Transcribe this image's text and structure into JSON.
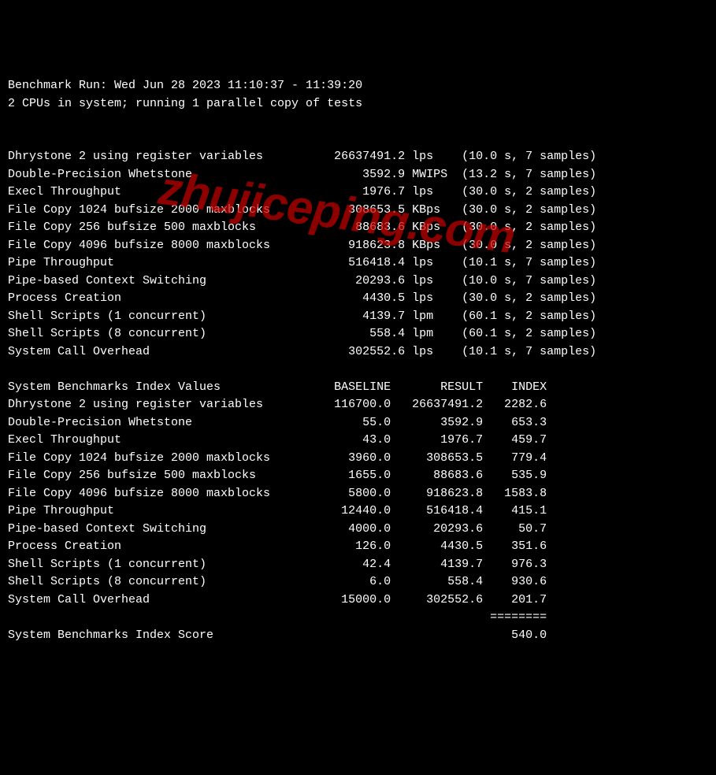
{
  "header": {
    "run_line": "Benchmark Run: Wed Jun 28 2023 11:10:37 - 11:39:20",
    "cpu_line": "2 CPUs in system; running 1 parallel copy of tests"
  },
  "results": [
    {
      "name": "Dhrystone 2 using register variables",
      "value": "26637491.2",
      "unit": "lps",
      "secs": "10.0",
      "samples": "7"
    },
    {
      "name": "Double-Precision Whetstone",
      "value": "3592.9",
      "unit": "MWIPS",
      "secs": "13.2",
      "samples": "7"
    },
    {
      "name": "Execl Throughput",
      "value": "1976.7",
      "unit": "lps",
      "secs": "30.0",
      "samples": "2"
    },
    {
      "name": "File Copy 1024 bufsize 2000 maxblocks",
      "value": "308653.5",
      "unit": "KBps",
      "secs": "30.0",
      "samples": "2"
    },
    {
      "name": "File Copy 256 bufsize 500 maxblocks",
      "value": "88683.6",
      "unit": "KBps",
      "secs": "30.0",
      "samples": "2"
    },
    {
      "name": "File Copy 4096 bufsize 8000 maxblocks",
      "value": "918623.8",
      "unit": "KBps",
      "secs": "30.0",
      "samples": "2"
    },
    {
      "name": "Pipe Throughput",
      "value": "516418.4",
      "unit": "lps",
      "secs": "10.1",
      "samples": "7"
    },
    {
      "name": "Pipe-based Context Switching",
      "value": "20293.6",
      "unit": "lps",
      "secs": "10.0",
      "samples": "7"
    },
    {
      "name": "Process Creation",
      "value": "4430.5",
      "unit": "lps",
      "secs": "30.0",
      "samples": "2"
    },
    {
      "name": "Shell Scripts (1 concurrent)",
      "value": "4139.7",
      "unit": "lpm",
      "secs": "60.1",
      "samples": "2"
    },
    {
      "name": "Shell Scripts (8 concurrent)",
      "value": "558.4",
      "unit": "lpm",
      "secs": "60.1",
      "samples": "2"
    },
    {
      "name": "System Call Overhead",
      "value": "302552.6",
      "unit": "lps",
      "secs": "10.1",
      "samples": "7"
    }
  ],
  "index_header": {
    "title": "System Benchmarks Index Values",
    "baseline": "BASELINE",
    "result": "RESULT",
    "index": "INDEX"
  },
  "index": [
    {
      "name": "Dhrystone 2 using register variables",
      "baseline": "116700.0",
      "result": "26637491.2",
      "index": "2282.6"
    },
    {
      "name": "Double-Precision Whetstone",
      "baseline": "55.0",
      "result": "3592.9",
      "index": "653.3"
    },
    {
      "name": "Execl Throughput",
      "baseline": "43.0",
      "result": "1976.7",
      "index": "459.7"
    },
    {
      "name": "File Copy 1024 bufsize 2000 maxblocks",
      "baseline": "3960.0",
      "result": "308653.5",
      "index": "779.4"
    },
    {
      "name": "File Copy 256 bufsize 500 maxblocks",
      "baseline": "1655.0",
      "result": "88683.6",
      "index": "535.9"
    },
    {
      "name": "File Copy 4096 bufsize 8000 maxblocks",
      "baseline": "5800.0",
      "result": "918623.8",
      "index": "1583.8"
    },
    {
      "name": "Pipe Throughput",
      "baseline": "12440.0",
      "result": "516418.4",
      "index": "415.1"
    },
    {
      "name": "Pipe-based Context Switching",
      "baseline": "4000.0",
      "result": "20293.6",
      "index": "50.7"
    },
    {
      "name": "Process Creation",
      "baseline": "126.0",
      "result": "4430.5",
      "index": "351.6"
    },
    {
      "name": "Shell Scripts (1 concurrent)",
      "baseline": "42.4",
      "result": "4139.7",
      "index": "976.3"
    },
    {
      "name": "Shell Scripts (8 concurrent)",
      "baseline": "6.0",
      "result": "558.4",
      "index": "930.6"
    },
    {
      "name": "System Call Overhead",
      "baseline": "15000.0",
      "result": "302552.6",
      "index": "201.7"
    }
  ],
  "footer": {
    "sep": "========",
    "label": "System Benchmarks Index Score",
    "score": "540.0"
  },
  "watermark": "zhujiceping.com"
}
